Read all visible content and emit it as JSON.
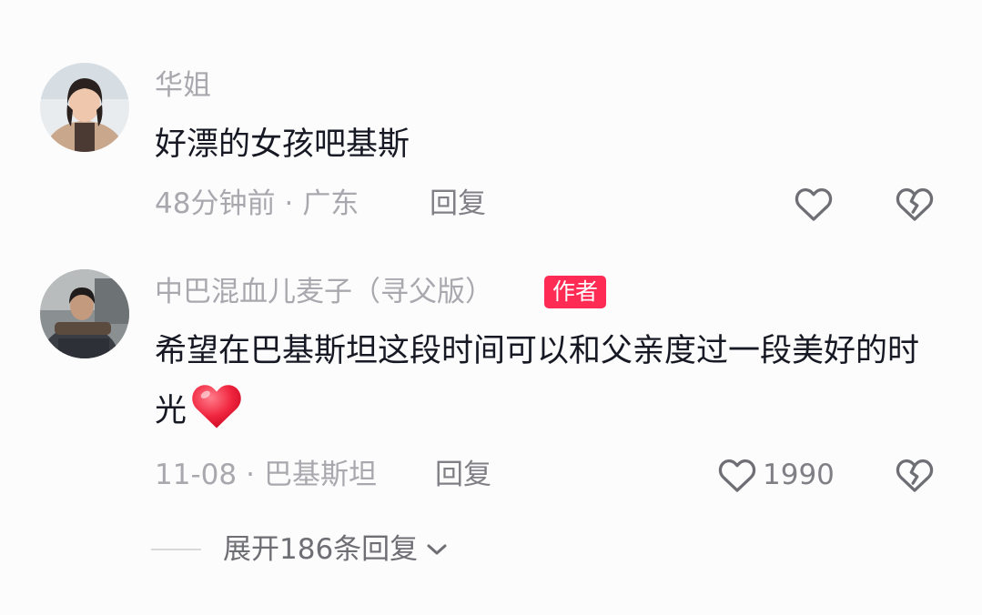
{
  "comments": [
    {
      "username": "华姐",
      "text": "好漂的女孩吧基斯",
      "time": "48分钟前",
      "separator": "·",
      "location": "广东",
      "reply_label": "回复",
      "like_count": ""
    },
    {
      "username": "中巴混血儿麦子（寻父版）",
      "author_badge": "作者",
      "text": "希望在巴基斯坦这段时间可以和父亲度过一段美好的时光",
      "emoji": "red-heart",
      "time": "11-08",
      "separator": "·",
      "location": "巴基斯坦",
      "reply_label": "回复",
      "like_count": "1990"
    }
  ],
  "expand_replies": {
    "label": "展开186条回复"
  },
  "colors": {
    "background": "#fcfcfc",
    "primary_text": "#161823",
    "secondary_text": "#a8a8ae",
    "author_badge": "#fe2c55",
    "heart_emoji": "#f0243e"
  },
  "icons": [
    "heart-outline-icon",
    "broken-heart-icon",
    "chevron-down-icon",
    "red-heart-emoji"
  ]
}
